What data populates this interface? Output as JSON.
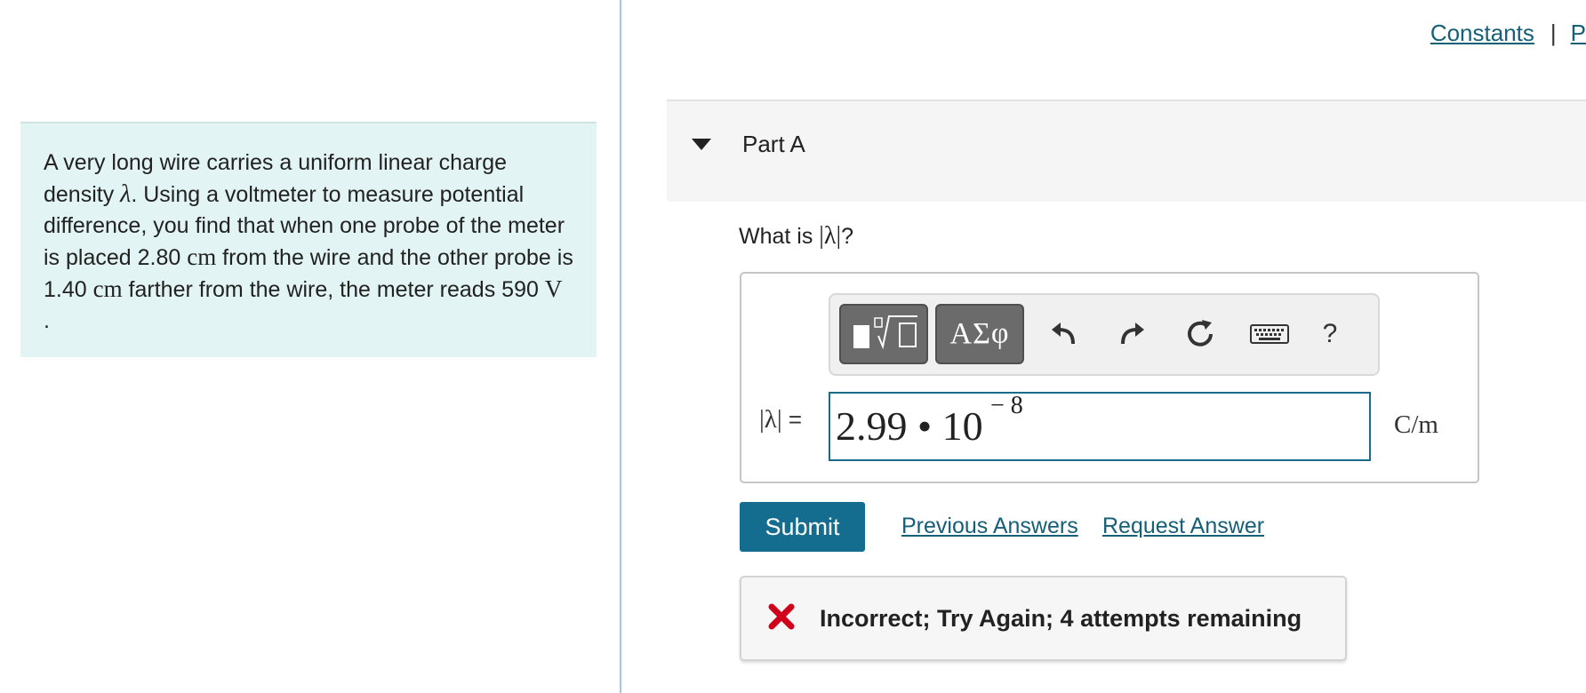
{
  "top_links": {
    "constants": "Constants",
    "separator": "|",
    "periodic": "P"
  },
  "problem": {
    "p1": "A very long wire carries a uniform linear charge density ",
    "lambda": "λ",
    "p2": ". Using a voltmeter to measure potential difference, you find that when one probe of the meter is placed 2.80 ",
    "unit_cm1": "cm",
    "p3": " from the wire and the other probe is 1.40 ",
    "unit_cm2": "cm",
    "p4": " farther from the wire, the meter reads 590 ",
    "unit_V": "V",
    "p5": " ."
  },
  "part": {
    "title": "Part A"
  },
  "question": {
    "prefix": "What is ",
    "math": "|λ|",
    "suffix": "?"
  },
  "toolbar": {
    "templates_icon": "templates-icon",
    "symbols_label": "ΑΣφ",
    "undo_icon": "undo-icon",
    "redo_icon": "redo-icon",
    "reset_icon": "reset-icon",
    "keyboard_icon": "keyboard-icon",
    "help_label": "?"
  },
  "answer": {
    "label_math": "|λ|",
    "label_eq": " =",
    "mantissa": "2.99 • 10",
    "exponent": "− 8",
    "unit": "C/m"
  },
  "actions": {
    "submit": "Submit",
    "previous_answers": "Previous Answers",
    "request_answer": "Request Answer"
  },
  "feedback": {
    "message": "Incorrect; Try Again; 4 attempts remaining",
    "status_color": "#d0021b"
  },
  "colors": {
    "accent": "#146c8e",
    "link": "#155f77",
    "problem_bg": "#e2f4f3"
  }
}
